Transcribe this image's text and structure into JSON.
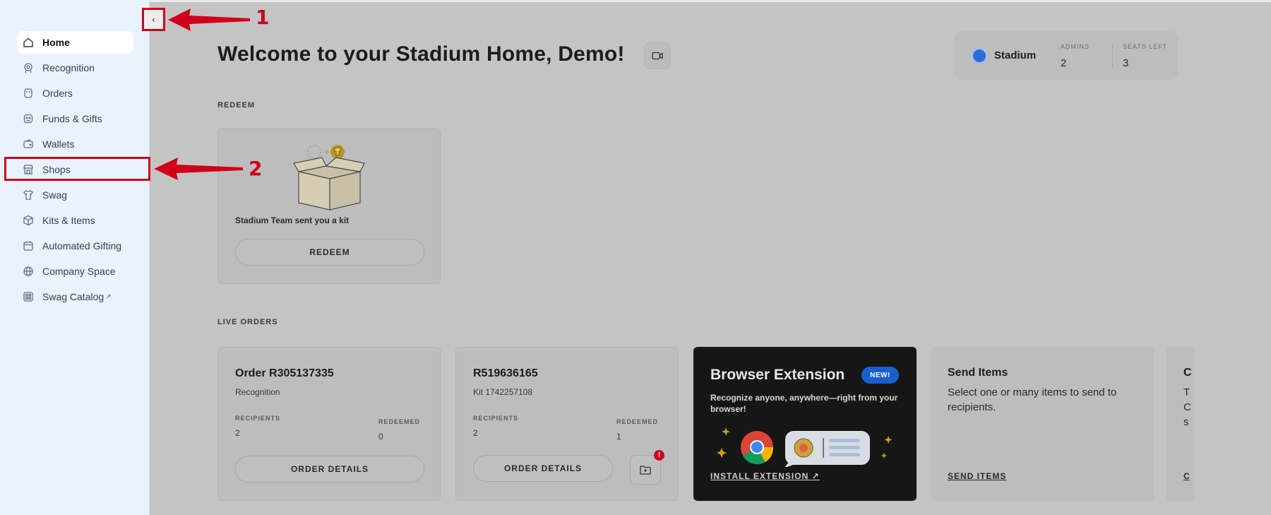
{
  "sidebar": {
    "items": [
      {
        "label": "Home",
        "icon": "home-icon",
        "active": true
      },
      {
        "label": "Recognition",
        "icon": "award-icon"
      },
      {
        "label": "Orders",
        "icon": "receipt-icon"
      },
      {
        "label": "Funds & Gifts",
        "icon": "gift-icon"
      },
      {
        "label": "Wallets",
        "icon": "wallet-icon"
      },
      {
        "label": "Shops",
        "icon": "store-icon"
      },
      {
        "label": "Swag",
        "icon": "shirt-icon"
      },
      {
        "label": "Kits & Items",
        "icon": "box-icon"
      },
      {
        "label": "Automated Gifting",
        "icon": "calendar-icon"
      },
      {
        "label": "Company Space",
        "icon": "globe-icon"
      },
      {
        "label": "Swag Catalog",
        "icon": "catalog-icon",
        "external": true
      }
    ],
    "collapse_glyph": "‹",
    "external_glyph": "↗"
  },
  "header": {
    "welcome": "Welcome to your Stadium Home, Demo!"
  },
  "account": {
    "name": "Stadium",
    "admins_label": "ADMINS",
    "admins_value": "2",
    "seats_label": "SEATS LEFT",
    "seats_value": "3"
  },
  "redeem": {
    "section_label": "REDEEM",
    "kit_text": "Stadium Team sent you a kit",
    "button_label": "REDEEM"
  },
  "live_orders": {
    "section_label": "LIVE ORDERS",
    "orders": [
      {
        "title": "Order R305137335",
        "subtitle": "Recognition",
        "recipients_label": "RECIPIENTS",
        "recipients": "2",
        "redeemed_label": "REDEEMED",
        "redeemed": "0",
        "button_label": "ORDER DETAILS"
      },
      {
        "title": "R519636165",
        "subtitle": "Kit 1742257108",
        "recipients_label": "RECIPIENTS",
        "recipients": "2",
        "redeemed_label": "REDEEMED",
        "redeemed": "1",
        "button_label": "ORDER DETAILS",
        "alert": "!"
      }
    ]
  },
  "extension": {
    "title": "Browser Extension",
    "badge": "NEW!",
    "description": "Recognize anyone, anywhere—right from your browser!",
    "link": "INSTALL EXTENSION ↗"
  },
  "send_items": {
    "title": "Send Items",
    "description": "Select one or many items to send to recipients.",
    "link": "SEND ITEMS"
  },
  "partial_card": {
    "title": "C",
    "desc_lines": [
      "T",
      "C",
      "s"
    ],
    "link": "C"
  },
  "annotations": {
    "one": "1",
    "two": "2"
  },
  "colors": {
    "annotation": "#d0021b",
    "sidebar_bg": "#e9f2fd",
    "overlay": "#c4c4c4",
    "badge_blue": "#1a5fd0"
  }
}
